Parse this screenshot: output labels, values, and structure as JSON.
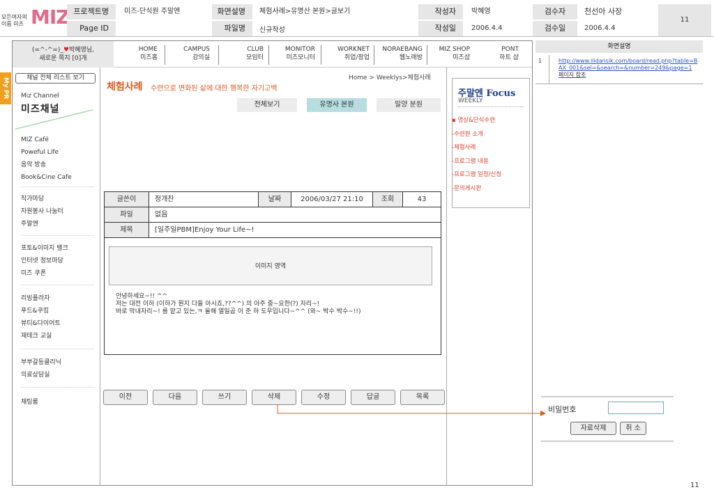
{
  "header": {
    "logo_small_line1": "모든여자의",
    "logo_small_line2": "이름 미즈",
    "logo_text": "MIZ",
    "project_label": "프로젝트명",
    "project_value": "미즈-단식원 주말엔",
    "pageid_label": "Page ID",
    "screen_label": "화면설명",
    "screen_value": "체험사례>유명산 본원>글보기",
    "file_label": "파일명",
    "file_value": "신규작성",
    "author_label": "작성자",
    "author_value": "박혜영",
    "date_label": "작성일",
    "date_value": "2006.4.4",
    "reviewer_label": "검수자",
    "reviewer_value": "천선아 사장",
    "reviewdate_label": "검수일",
    "reviewdate_value": "2006.4.4",
    "page_number": "11"
  },
  "topnav": {
    "user_line1": "(=^-^=)_",
    "user_heart": "♥",
    "user_name": "박혜영님,",
    "user_line2": "새로운 쪽지 [0]개",
    "items": [
      {
        "en": "HOME",
        "ko": "미즈홈"
      },
      {
        "en": "CAMPUS",
        "ko": "강의실"
      },
      {
        "en": "CLUB",
        "ko": "모임터"
      },
      {
        "en": "MONITOR",
        "ko": "미즈모니터"
      },
      {
        "en": "WORKNET",
        "ko": "취업/창업"
      },
      {
        "en": "NORAEBANG",
        "ko": "웹노래방"
      },
      {
        "en": "MIZ SHOP",
        "ko": "미즈샵"
      },
      {
        "en": "PONT",
        "ko": "하트 샵"
      }
    ]
  },
  "sidebar": {
    "mypr": "My PR",
    "channel_button": "채널 전체 리스트 보기",
    "channel_en": "Miz Channel",
    "channel_ko": "미즈채널",
    "groups": [
      [
        "MIZ Café",
        "Poweful Life",
        "음악 방송",
        "Book&Cine Cafe"
      ],
      [
        "작가마당",
        "자원봉사 나눔터",
        "주말엔"
      ],
      [
        "포토&이미지 뱅크",
        "인터넷 정보마당",
        "미즈 쿠폰"
      ],
      [
        "리빙플라자",
        "푸드&쿠킹",
        "뷰티&다이어트",
        "재테크 교실"
      ],
      [
        "부부갈등클리닉",
        "의료상담실"
      ],
      [
        "채팅룸"
      ]
    ]
  },
  "content": {
    "breadcrumb": "Home > Weeklys>체험사례",
    "title": "체험사례",
    "subtitle": "수련으로 변화된 삶에 대한 행복한 자기고백",
    "tabs": [
      "전체보기",
      "유명사 본원",
      "밀양 분원"
    ],
    "article": {
      "author_label": "글쓴이",
      "author": "정개찬",
      "date_label": "날짜",
      "date": "2006/03/27 21:10",
      "views_label": "조회",
      "views": "43",
      "file_label": "파일",
      "file": "없음",
      "subject_label": "제목",
      "subject": "[일주일PBM]Enjoy Your Life~!",
      "image_area": "이미지 영역",
      "body_line1": "안녕하세요~!! ^^",
      "body_line2": "저는 대전 이하 (이하가 뭔지 다들 아시죠,??^^) 의 아주 중~요한(?) 자리~!",
      "body_line3": "바로 막내자리~! 를 맡고 있는,ㅋ 올해 열일곱 이 준 하 도우입니다~^^ (와~ 박수 박수~!!)"
    },
    "buttons": [
      "이전",
      "다음",
      "쓰기",
      "삭제",
      "수정",
      "답글",
      "목록"
    ]
  },
  "focus": {
    "title_ko": "주말엔",
    "title_en": "Focus",
    "weekly": "WEEKLY",
    "items": [
      "▪ 명상&단식수련",
      "-수련원 소개",
      "-체험사례",
      "-프로그램 내용",
      "-프로그램 일정/신청",
      "-문의게시판"
    ]
  },
  "right_panel": {
    "title": "화면설명",
    "row_number": "1",
    "link": "http://www.ilidansik.com/board/read.php?table=BAX_001&sel=&search=&number=249&page=1",
    "link_note": "페이지 참조",
    "pw_label": "비밀번호",
    "delete_button": "자료삭제",
    "cancel_button": "취 소"
  },
  "footer": {
    "page_number": "11"
  }
}
